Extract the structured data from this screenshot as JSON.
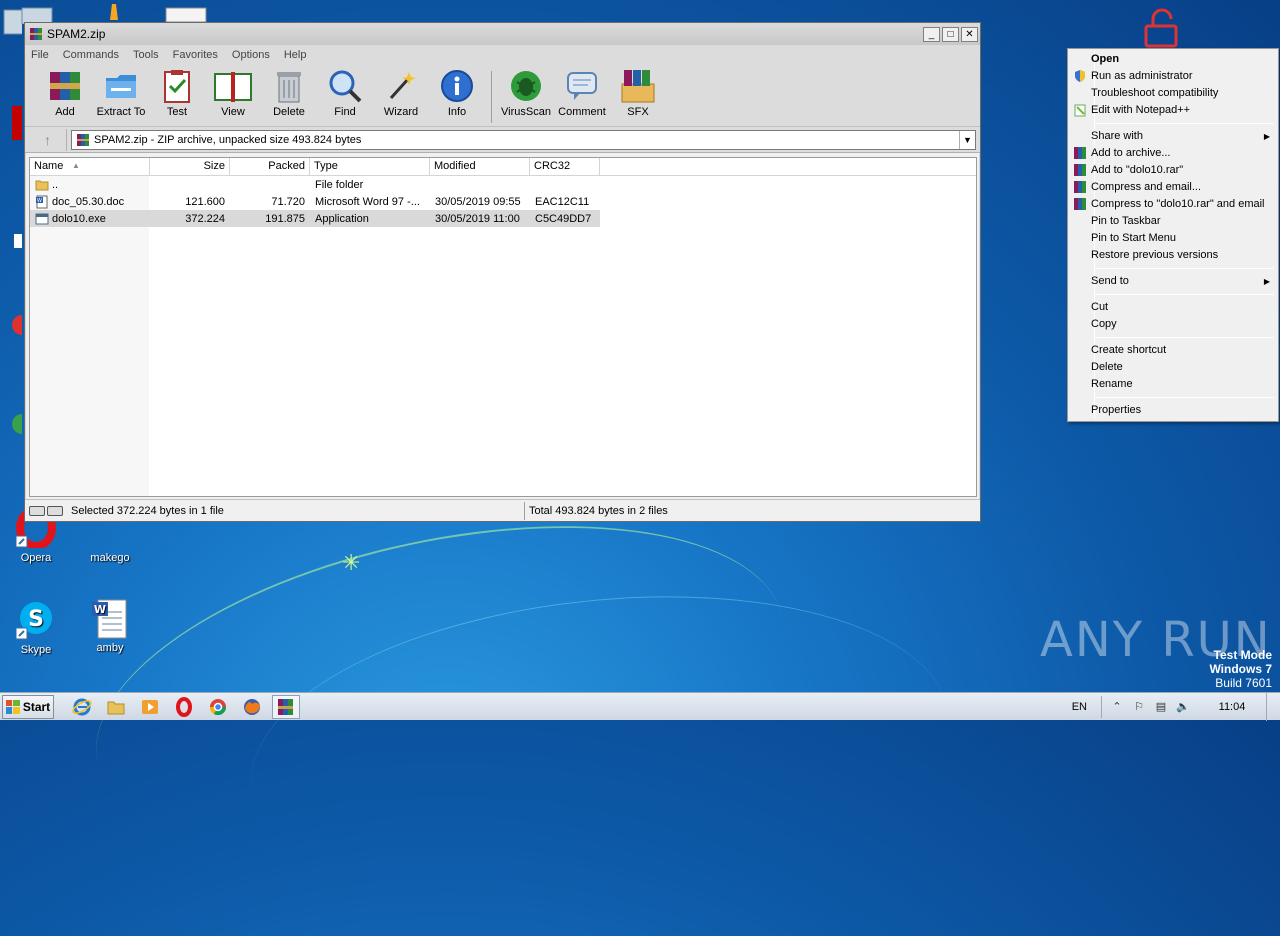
{
  "window": {
    "title": "SPAM2.zip",
    "menu": [
      "File",
      "Commands",
      "Tools",
      "Favorites",
      "Options",
      "Help"
    ],
    "toolbar": [
      {
        "label": "Add",
        "icon": "add-archive-icon"
      },
      {
        "label": "Extract To",
        "icon": "extract-folder-icon"
      },
      {
        "label": "Test",
        "icon": "test-clipboard-icon"
      },
      {
        "label": "View",
        "icon": "view-book-icon"
      },
      {
        "label": "Delete",
        "icon": "delete-trash-icon"
      },
      {
        "label": "Find",
        "icon": "find-magnifier-icon"
      },
      {
        "label": "Wizard",
        "icon": "wizard-wand-icon"
      },
      {
        "label": "Info",
        "icon": "info-icon"
      },
      {
        "label": "VirusScan",
        "icon": "virusscan-bug-icon"
      },
      {
        "label": "Comment",
        "icon": "comment-bubble-icon"
      },
      {
        "label": "SFX",
        "icon": "sfx-box-icon"
      }
    ],
    "address": "SPAM2.zip - ZIP archive, unpacked size 493.824 bytes",
    "columns": [
      "Name",
      "Size",
      "Packed",
      "Type",
      "Modified",
      "CRC32"
    ],
    "files": [
      {
        "name": "..",
        "size": "",
        "packed": "",
        "type": "File folder",
        "modified": "",
        "crc": "",
        "icon": "folder-icon"
      },
      {
        "name": "doc_05.30.doc",
        "size": "121.600",
        "packed": "71.720",
        "type": "Microsoft Word 97 -...",
        "modified": "30/05/2019 09:55",
        "crc": "EAC12C11",
        "icon": "word-doc-icon"
      },
      {
        "name": "dolo10.exe",
        "size": "372.224",
        "packed": "191.875",
        "type": "Application",
        "modified": "30/05/2019 11:00",
        "crc": "C5C49DD7",
        "icon": "exe-app-icon",
        "selected": true
      }
    ],
    "status_left": "Selected 372.224 bytes in 1 file",
    "status_right": "Total 493.824 bytes in 2 files"
  },
  "context_menu": [
    {
      "label": "Open",
      "bold": true
    },
    {
      "label": "Run as administrator",
      "icon": "uac-shield-icon"
    },
    {
      "label": "Troubleshoot compatibility"
    },
    {
      "label": "Edit with Notepad++",
      "icon": "notepadpp-icon"
    },
    {
      "sep": true
    },
    {
      "label": "Share with",
      "submenu": true
    },
    {
      "label": "Add to archive...",
      "icon": "winrar-icon"
    },
    {
      "label": "Add to \"dolo10.rar\"",
      "icon": "winrar-icon"
    },
    {
      "label": "Compress and email...",
      "icon": "winrar-icon"
    },
    {
      "label": "Compress to \"dolo10.rar\" and email",
      "icon": "winrar-icon"
    },
    {
      "label": "Pin to Taskbar"
    },
    {
      "label": "Pin to Start Menu"
    },
    {
      "label": "Restore previous versions"
    },
    {
      "sep": true
    },
    {
      "label": "Send to",
      "submenu": true
    },
    {
      "sep": true
    },
    {
      "label": "Cut"
    },
    {
      "label": "Copy"
    },
    {
      "sep": true
    },
    {
      "label": "Create shortcut"
    },
    {
      "label": "Delete"
    },
    {
      "label": "Rename"
    },
    {
      "sep": true
    },
    {
      "label": "Properties"
    }
  ],
  "desktop": {
    "icons": [
      {
        "label": "Opera",
        "icon": "opera-icon"
      },
      {
        "label": "makego",
        "icon": "makego-icon"
      },
      {
        "label": "Skype",
        "icon": "skype-icon"
      },
      {
        "label": "amby",
        "icon": "word-doc-icon"
      }
    ],
    "watermark_line1": "Test Mode",
    "watermark_line2": "Windows 7",
    "watermark_line3": "Build 7601",
    "anyrun": "ANY RUN"
  },
  "taskbar": {
    "start": "Start",
    "lang": "EN",
    "time": "11:04",
    "apps": [
      "ie-icon",
      "explorer-folder-icon",
      "media-player-icon",
      "opera-icon",
      "chrome-icon",
      "firefox-icon",
      "winrar-icon"
    ]
  },
  "colors": {
    "desktop": "#0d5aa8",
    "selection": "#d9d9d9",
    "menu_bg": "#f0f0f0"
  }
}
